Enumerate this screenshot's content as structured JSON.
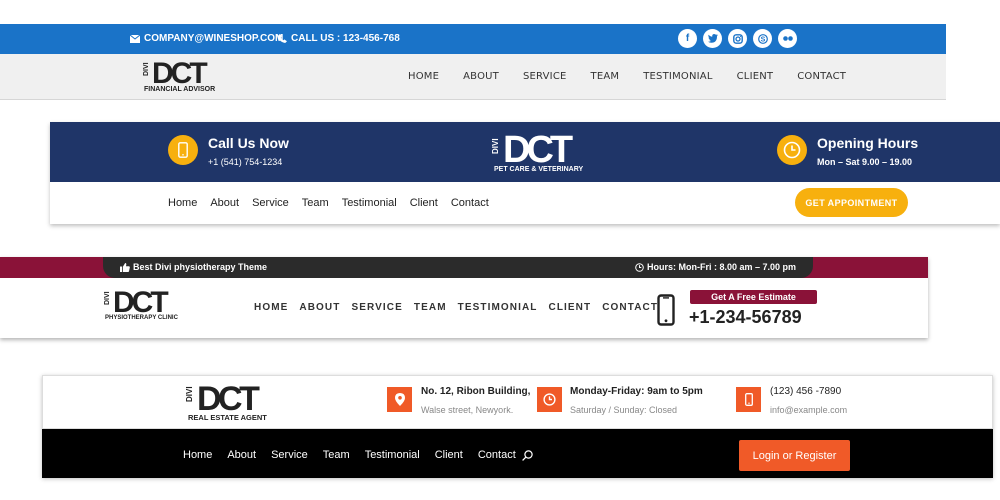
{
  "header1": {
    "email": "COMPANY@WINESHOP.COM",
    "phone": "CALL US : 123-456-768",
    "logo_text": "DCT",
    "logo_prefix": "DIVI",
    "logo_sub": "FINANCIAL ADVISOR",
    "nav": [
      "HOME",
      "ABOUT",
      "SERVICE",
      "TEAM",
      "TESTIMONIAL",
      "CLIENT",
      "CONTACT"
    ],
    "social": [
      "facebook-icon",
      "twitter-icon",
      "instagram-icon",
      "skype-icon",
      "flickr-icon"
    ],
    "colors": {
      "topbar": "#1a73c8",
      "mainbar": "#f0f0f0"
    }
  },
  "header2": {
    "call_title": "Call Us Now",
    "call_number": "+1 (541) 754-1234",
    "logo_text": "DCT",
    "logo_prefix": "DIVI",
    "logo_sub": "PET CARE & VETERINARY",
    "hours_title": "Opening Hours",
    "hours_value": "Mon – Sat 9.00 – 19.00",
    "nav": [
      "Home",
      "About",
      "Service",
      "Team",
      "Testimonial",
      "Client",
      "Contact"
    ],
    "button": "GET APPOINTMENT",
    "colors": {
      "topbar": "#1f3568",
      "accent": "#f7b00e"
    }
  },
  "header3": {
    "tagline": "Best Divi physiotherapy Theme",
    "hours": "Hours: Mon-Fri : 8.00 am – 7.00 pm",
    "logo_text": "DCT",
    "logo_prefix": "DIVI",
    "logo_sub": "PHYSIOTHERAPY CLINIC",
    "nav": [
      "HOME",
      "ABOUT",
      "SERVICE",
      "TEAM",
      "TESTIMONIAL",
      "CLIENT",
      "CONTACT"
    ],
    "estimate": "Get A Free Estimate",
    "phone": "+1-234-56789",
    "colors": {
      "accent": "#8a1238",
      "pill": "#2b2b2b"
    }
  },
  "header4": {
    "logo_text": "DCT",
    "logo_prefix": "DIVI",
    "logo_sub": "REAL ESTATE AGENT",
    "address1": "No. 12, Ribon Building,",
    "address2": "Walse street, Newyork.",
    "hours1": "Monday-Friday: 9am to 5pm",
    "hours2": "Saturday / Sunday: Closed",
    "phone": "(123) 456 -7890",
    "email": "info@example.com",
    "nav": [
      "Home",
      "About",
      "Service",
      "Team",
      "Testimonial",
      "Client",
      "Contact"
    ],
    "button": "Login or Register",
    "colors": {
      "accent": "#f05a28",
      "mainbar": "#000000"
    }
  }
}
